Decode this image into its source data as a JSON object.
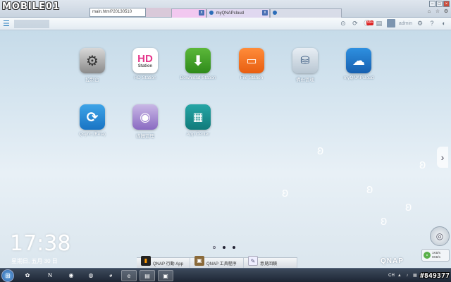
{
  "watermark": {
    "logo": "MOBILE01",
    "id": "#849377"
  },
  "browser": {
    "address": "main.html?20130510",
    "tabs": [
      {
        "label": ""
      },
      {
        "label": "myQNAPcloud"
      },
      {
        "label": ""
      }
    ],
    "close_glyph": "x"
  },
  "topbar": {
    "notification_count": "99+",
    "user": "admin",
    "icons": [
      "search-icon",
      "refresh-icon",
      "notification-icon",
      "user-icon",
      "settings-icon",
      "help-icon",
      "dashboard-icon"
    ]
  },
  "apps": [
    {
      "label": "控制台",
      "tile_text": "⚙",
      "icon": "control-panel-icon"
    },
    {
      "label": "HD Station",
      "tile_text": "HD",
      "tile_sub": "Station",
      "icon": "hd-station-icon"
    },
    {
      "label": "Download Station",
      "tile_text": "⬇",
      "icon": "download-station-icon"
    },
    {
      "label": "File Station",
      "tile_text": "▭",
      "icon": "file-station-icon"
    },
    {
      "label": "備份管理",
      "tile_text": "⛁",
      "icon": "backup-manager-icon"
    },
    {
      "label": "myQNAPcloud",
      "tile_text": "☁",
      "icon": "myqnapcloud-icon"
    },
    {
      "label": "Qsync (Beta)",
      "tile_text": "⟳",
      "icon": "qsync-icon"
    },
    {
      "label": "媒體管理",
      "tile_text": "◉",
      "icon": "media-manager-icon"
    },
    {
      "label": "App Center",
      "tile_text": "▦",
      "icon": "app-center-icon"
    }
  ],
  "clock": {
    "time": "17:38",
    "date": "星期日, 五月 30 日"
  },
  "dock": [
    {
      "label": "QNAP 行動 App",
      "icon": "mobile-app-icon"
    },
    {
      "label": "QNAP 工具程序",
      "icon": "utility-icon"
    },
    {
      "label": "意見回饋",
      "icon": "feedback-icon"
    }
  ],
  "net_widget": {
    "up": "1KB/s",
    "down": "0KB/s"
  },
  "brand": "QNAP",
  "taskbar": {
    "language": "CH"
  }
}
